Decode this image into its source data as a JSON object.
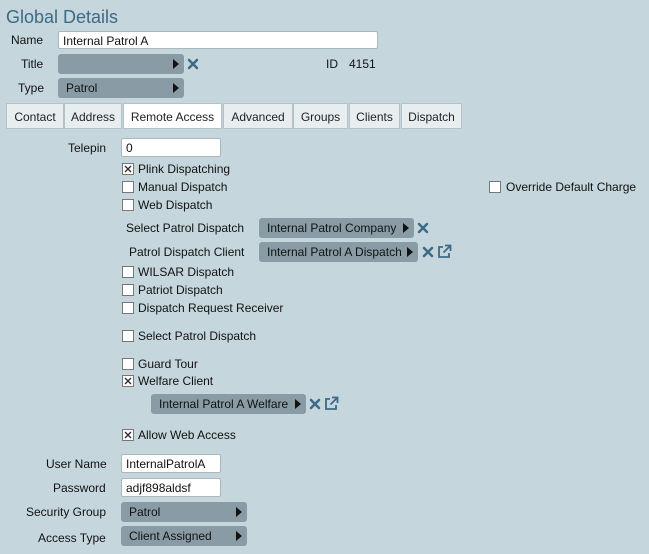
{
  "header": {
    "title": "Global Details"
  },
  "fields": {
    "name": {
      "label": "Name",
      "value": "Internal Patrol A"
    },
    "title": {
      "label": "Title",
      "value": ""
    },
    "id": {
      "label": "ID",
      "value": "4151"
    },
    "type": {
      "label": "Type",
      "value": "Patrol"
    }
  },
  "tabs": [
    {
      "label": "Contact"
    },
    {
      "label": "Address"
    },
    {
      "label": "Remote Access"
    },
    {
      "label": "Advanced"
    },
    {
      "label": "Groups"
    },
    {
      "label": "Clients"
    },
    {
      "label": "Dispatch"
    }
  ],
  "active_tab": "Remote Access",
  "remote": {
    "telepin": {
      "label": "Telepin",
      "value": "0"
    },
    "plink_dispatching": {
      "label": "Plink Dispatching",
      "checked": true
    },
    "manual_dispatch": {
      "label": "Manual Dispatch",
      "checked": false
    },
    "override_default_charge": {
      "label": "Override Default Charge",
      "checked": false
    },
    "web_dispatch": {
      "label": "Web Dispatch",
      "checked": false
    },
    "select_patrol_dispatch": {
      "label": "Select Patrol Dispatch",
      "value": "Internal Patrol Company"
    },
    "patrol_dispatch_client": {
      "label": "Patrol Dispatch Client",
      "value": "Internal Patrol A Dispatch"
    },
    "wilsar_dispatch": {
      "label": "WILSAR Dispatch",
      "checked": false
    },
    "patriot_dispatch": {
      "label": "Patriot Dispatch",
      "checked": false
    },
    "dispatch_request_receiver": {
      "label": "Dispatch Request Receiver",
      "checked": false
    },
    "select_patrol_dispatch_cb": {
      "label": "Select Patrol Dispatch",
      "checked": false
    },
    "guard_tour": {
      "label": "Guard Tour",
      "checked": false
    },
    "welfare_client": {
      "label": "Welfare Client",
      "checked": true
    },
    "welfare_client_value": "Internal Patrol A Welfare",
    "allow_web_access": {
      "label": "Allow Web Access",
      "checked": true
    },
    "user_name": {
      "label": "User Name",
      "value": "InternalPatrolA"
    },
    "password": {
      "label": "Password",
      "value": "adjf898aldsf"
    },
    "security_group": {
      "label": "Security Group",
      "value": "Patrol"
    },
    "access_type": {
      "label": "Access Type",
      "value": "Client Assigned"
    }
  },
  "colors": {
    "background": "#c6d6dd",
    "title": "#3d6a86",
    "pill": "#899ca6",
    "icon": "#3d6a86"
  }
}
